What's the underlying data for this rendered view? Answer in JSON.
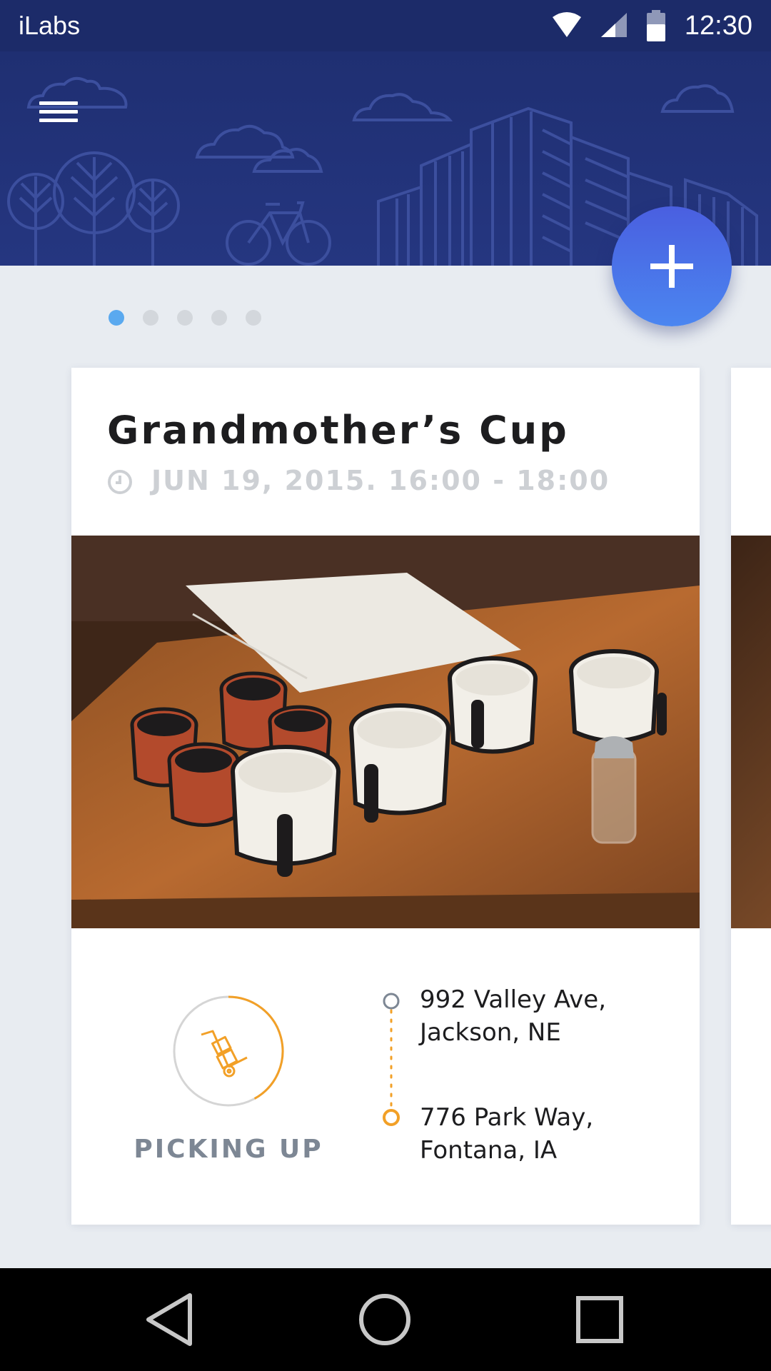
{
  "status_bar": {
    "app_name": "iLabs",
    "time": "12:30",
    "icons": [
      "wifi-icon",
      "signal-icon",
      "battery-icon"
    ]
  },
  "header": {
    "menu_icon": "hamburger-menu-icon",
    "illustration": "city-skyline-trees-bicycle-clouds"
  },
  "fab": {
    "icon": "plus-icon",
    "color": "#4b6ff0"
  },
  "pager": {
    "count": 5,
    "active_index": 0,
    "active_color": "#5aa9ef"
  },
  "card": {
    "title": "Grandmother’s Cup",
    "date": "JUN 19, 2015. 16:00 - 18:00",
    "photo": "enamel-mugs-on-wooden-table",
    "status": {
      "label": "PICKING UP",
      "icon": "hand-truck-icon",
      "progress_fraction": 0.42,
      "accent_color": "#f2a027"
    },
    "route": {
      "from": "992 Valley Ave, Jackson, NE",
      "to": "776 Park Way, Fontana, IA"
    }
  },
  "nav_bar": {
    "buttons": [
      "back-icon",
      "home-icon",
      "recents-icon"
    ]
  }
}
